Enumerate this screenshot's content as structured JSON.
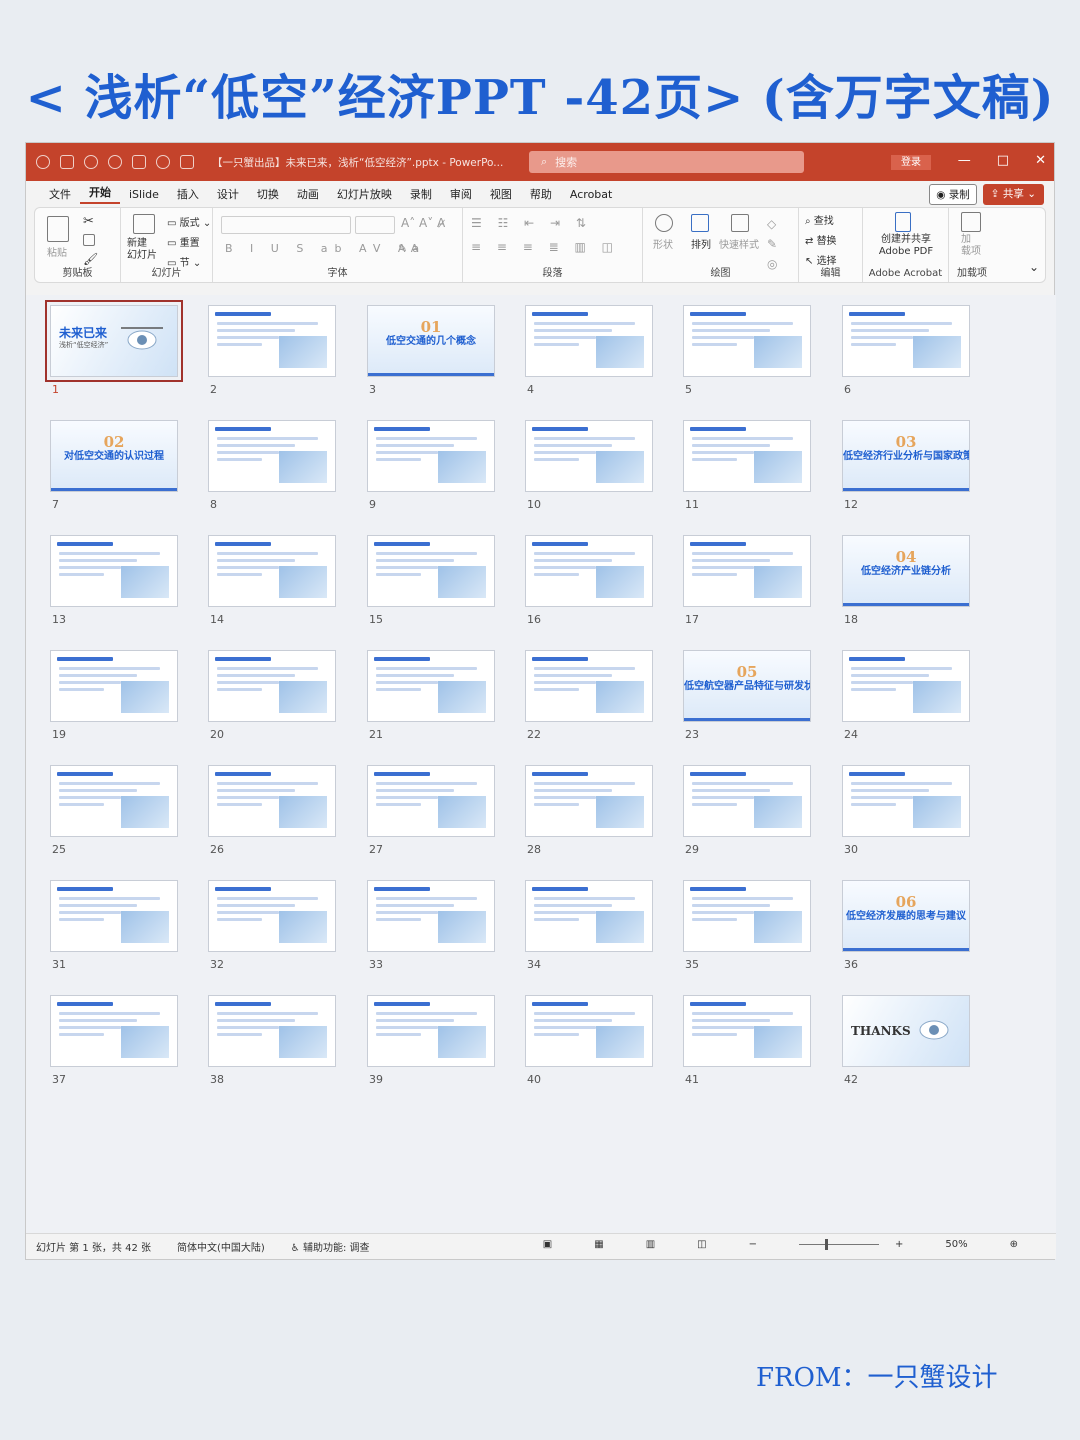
{
  "headline": "< 浅析“低空”经济PPT -42页> (含万字文稿)",
  "titlebar": {
    "file_title": "【一只蟹出品】未来已来，浅析“低空经济”.pptx  -  PowerPo...",
    "search_placeholder": "搜索",
    "login_label": "登录",
    "minimize": "—",
    "maximize": "□",
    "close": "✕"
  },
  "menu": {
    "items": [
      "文件",
      "开始",
      "iSlide",
      "插入",
      "设计",
      "切换",
      "动画",
      "幻灯片放映",
      "录制",
      "审阅",
      "视图",
      "帮助",
      "Acrobat"
    ],
    "record_label": "录制",
    "share_label": "共享"
  },
  "ribbon": {
    "clipboard": {
      "paste": "粘贴",
      "label": "剪贴板"
    },
    "slides": {
      "new_slide": "新建\n幻灯片",
      "layout": "版式",
      "reset": "重置",
      "section": "节",
      "label": "幻灯片"
    },
    "font": {
      "label": "字体"
    },
    "paragraph": {
      "label": "段落"
    },
    "drawing": {
      "shape": "形状",
      "arrange": "排列",
      "quick_styles": "快速样式",
      "label": "绘图"
    },
    "editing": {
      "find": "查找",
      "replace": "替换",
      "select": "选择",
      "label": "编辑"
    },
    "acrobat": {
      "create_share": "创建并共享\nAdobe PDF",
      "label": "Adobe Acrobat"
    },
    "addins": {
      "addins": "加\n载项",
      "label": "加载项"
    }
  },
  "slides": {
    "count": 42,
    "selected": 1,
    "cover": {
      "title": "未来已来",
      "subtitle": "浅析“低空经济”"
    },
    "thanks": "THANKS",
    "sections": {
      "3": {
        "num": "01",
        "title": "低空交通的几个概念"
      },
      "7": {
        "num": "02",
        "title": "对低空交通的认识过程"
      },
      "12": {
        "num": "03",
        "title": "低空经济行业分析与国家政策"
      },
      "18": {
        "num": "04",
        "title": "低空经济产业链分析"
      },
      "23": {
        "num": "05",
        "title": "低空航空器产品特征与研发状况"
      },
      "36": {
        "num": "06",
        "title": "低空经济发展的思考与建议"
      }
    }
  },
  "statusbar": {
    "slide_info": "幻灯片 第 1 张，共 42 张",
    "language": "简体中文(中国大陆)",
    "accessibility": "辅助功能: 调查",
    "zoom": "50%"
  },
  "footer": "FROM：一只蟹设计",
  "colors": {
    "accent": "#c4432b",
    "brand_blue": "#1f5fd0"
  }
}
